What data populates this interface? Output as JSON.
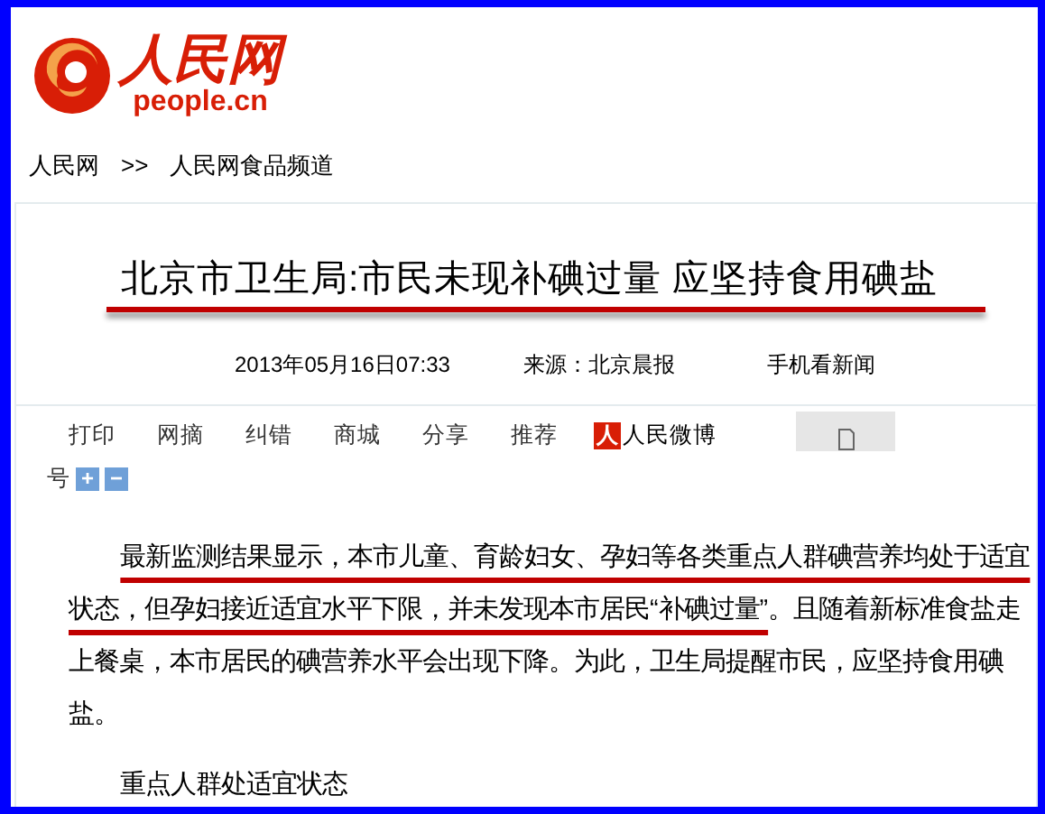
{
  "logo": {
    "mark": "人民网",
    "domain": "people.cn"
  },
  "breadcrumb": [
    {
      "label": "人民网"
    },
    {
      "label": ">>"
    },
    {
      "label": "人民网食品频道"
    }
  ],
  "headline": "北京市卫生局:市民未现补碘过量 应坚持食用碘盐",
  "meta": {
    "date": "2013年05月16日07:33",
    "source": "来源：北京晨报",
    "mobile": "手机看新闻"
  },
  "toolbar": [
    {
      "label": "打印"
    },
    {
      "label": "网摘"
    },
    {
      "label": "纠错"
    },
    {
      "label": "商城"
    },
    {
      "label": "分享"
    },
    {
      "label": "推荐"
    }
  ],
  "weibo": {
    "icon_char": "人",
    "label": "人民微博"
  },
  "font_size": {
    "label": "号",
    "buttons": [
      "+",
      "−"
    ]
  },
  "body": [
    {
      "kind": "paragraph",
      "segments": [
        {
          "text": "最新监测结果显示，本市儿童、育龄妇女、孕妇等各类重点人群碘营养均处于适宜状态，但孕妇接近适宜水平下限，并未发现本市居民“补碘过量”",
          "underlined": true
        },
        {
          "text": "。且随着新标准食盐走上餐桌，本市居民的碘营养水平会出现下降。为此，卫生局提醒市民，应坚持食用碘盐。",
          "underlined": false
        }
      ]
    },
    {
      "kind": "subheading",
      "text": "重点人群处适宜状态"
    }
  ]
}
